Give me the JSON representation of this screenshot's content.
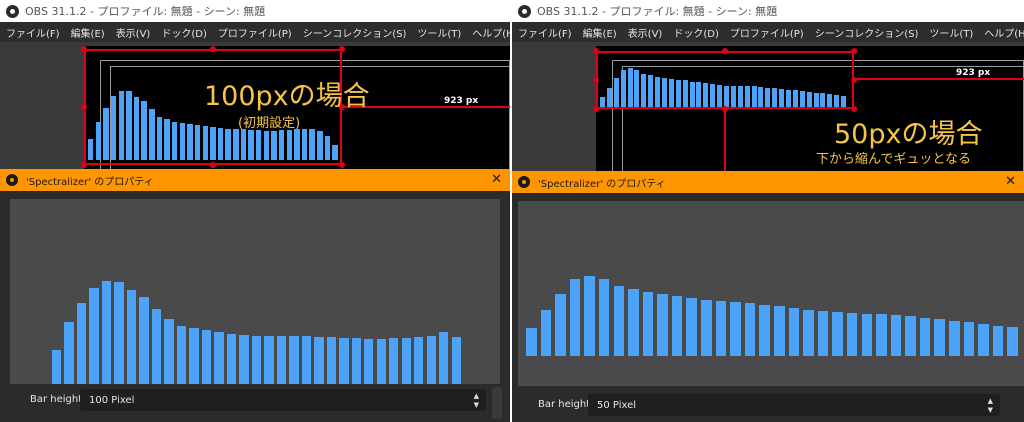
{
  "left": {
    "window_title": "OBS 31.1.2 - プロファイル: 無題 - シーン: 無題",
    "menu": [
      "ファイル(F)",
      "編集(E)",
      "表示(V)",
      "ドック(D)",
      "プロファイル(P)",
      "シーンコレクション(S)",
      "ツール(T)",
      "ヘルプ(H)"
    ],
    "px_label": "923 px",
    "annotation_main": "100pxの場合",
    "annotation_sub": "(初期設定)",
    "dialog_title": "'Spectralizer' のプロパティ",
    "close_label": "✕",
    "bar_height_label": "Bar height",
    "bar_height_value": "100 Pixel",
    "spectrum_levels": [
      0.3,
      0.55,
      0.75,
      0.91,
      0.98,
      0.98,
      0.9,
      0.84,
      0.73,
      0.62,
      0.58,
      0.55,
      0.53,
      0.52,
      0.5,
      0.49,
      0.47,
      0.46,
      0.45,
      0.44,
      0.44,
      0.43,
      0.43,
      0.42,
      0.42,
      0.43,
      0.43,
      0.44,
      0.44,
      0.45,
      0.42,
      0.35,
      0.22
    ],
    "preview_levels": [
      0.3,
      0.55,
      0.72,
      0.86,
      0.92,
      0.91,
      0.84,
      0.78,
      0.67,
      0.58,
      0.52,
      0.5,
      0.48,
      0.46,
      0.45,
      0.44,
      0.43,
      0.43,
      0.43,
      0.43,
      0.43,
      0.42,
      0.42,
      0.41,
      0.41,
      0.4,
      0.4,
      0.41,
      0.41,
      0.42,
      0.43,
      0.46,
      0.42
    ]
  },
  "right": {
    "window_title": "OBS 31.1.2 - プロファイル: 無題 - シーン: 無題",
    "menu": [
      "ファイル(F)",
      "編集(E)",
      "表示(V)",
      "ドック(D)",
      "プロファイル(P)",
      "シーンコレクション(S)",
      "ツール(T)",
      "ヘルプ(H)"
    ],
    "px_label": "923 px",
    "annotation_main": "50pxの場合",
    "annotation_sub": "下から縮んでギュッとなる",
    "dialog_title": "'Spectralizer' のプロパティ",
    "close_label": "✕",
    "bar_height_label": "Bar height",
    "bar_height_value": "50 Pixel",
    "spectrum_levels": [
      0.28,
      0.49,
      0.74,
      0.96,
      1.0,
      0.96,
      0.86,
      0.82,
      0.78,
      0.74,
      0.73,
      0.71,
      0.69,
      0.66,
      0.64,
      0.62,
      0.6,
      0.57,
      0.56,
      0.55,
      0.55,
      0.55,
      0.55,
      0.52,
      0.51,
      0.49,
      0.48,
      0.46,
      0.44,
      0.43,
      0.4,
      0.38,
      0.37,
      0.36,
      0.33,
      0.3
    ],
    "preview_levels": [
      0.35,
      0.58,
      0.78,
      0.96,
      1.0,
      0.96,
      0.88,
      0.84,
      0.8,
      0.77,
      0.75,
      0.73,
      0.7,
      0.69,
      0.68,
      0.66,
      0.64,
      0.62,
      0.6,
      0.58,
      0.56,
      0.55,
      0.54,
      0.53,
      0.52,
      0.51,
      0.5,
      0.48,
      0.46,
      0.44,
      0.42,
      0.4,
      0.38,
      0.36
    ]
  },
  "colors": {
    "accent_orange": "#ff9500",
    "bar_blue": "#4da3f7",
    "annotation_yellow": "#f6c546",
    "selection_red": "#e0001a"
  }
}
